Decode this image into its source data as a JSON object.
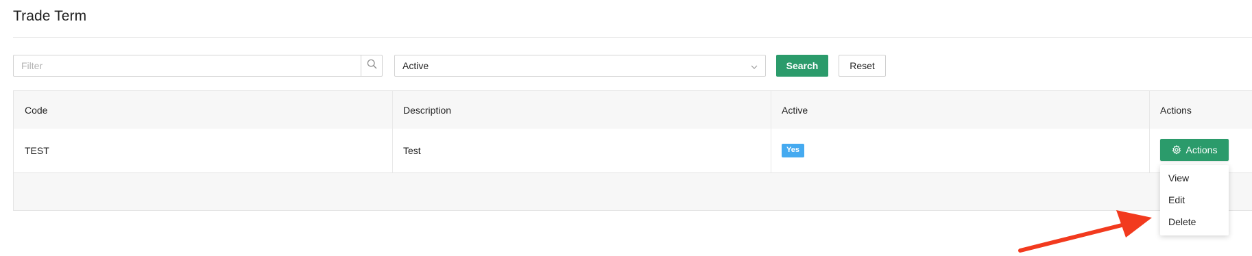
{
  "page": {
    "title": "Trade Term"
  },
  "filters": {
    "filter_placeholder": "Filter",
    "filter_value": "",
    "status_selected": "Active",
    "search_label": "Search",
    "reset_label": "Reset"
  },
  "table": {
    "columns": [
      "Code",
      "Description",
      "Active",
      "Actions"
    ],
    "rows": [
      {
        "code": "TEST",
        "description": "Test",
        "active": "Yes"
      }
    ]
  },
  "actions_button": {
    "label": "Actions"
  },
  "actions_menu": {
    "items": [
      {
        "label": "View"
      },
      {
        "label": "Edit"
      },
      {
        "label": "Delete"
      }
    ]
  },
  "colors": {
    "primary_green": "#2b9b6b",
    "badge_blue": "#45aaf0",
    "annotation_red": "#f23a1e"
  },
  "icons": {
    "filter_search": "search-icon",
    "status_dropdown": "chevron-down-icon",
    "actions": "gear-icon",
    "annotation": "arrow-annotation"
  }
}
